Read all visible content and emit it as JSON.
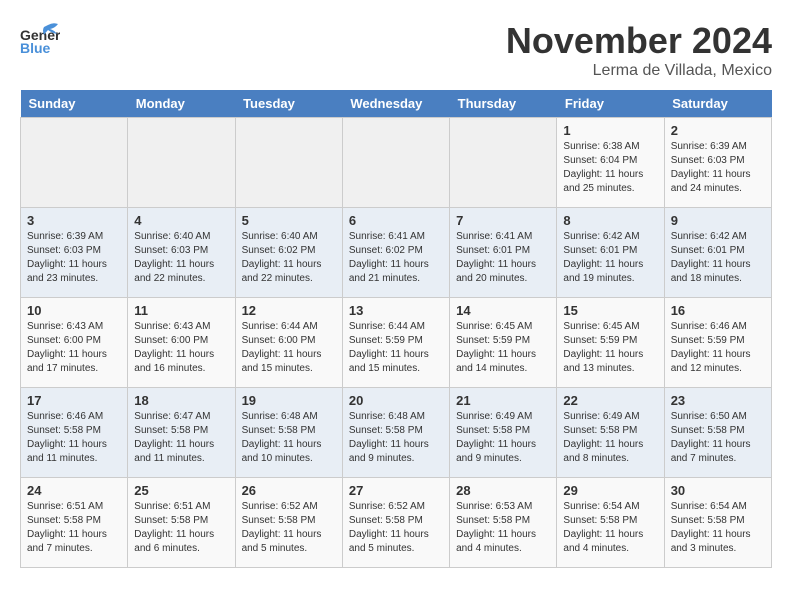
{
  "logo": {
    "line1": "General",
    "line2": "Blue"
  },
  "title": "November 2024",
  "subtitle": "Lerma de Villada, Mexico",
  "weekdays": [
    "Sunday",
    "Monday",
    "Tuesday",
    "Wednesday",
    "Thursday",
    "Friday",
    "Saturday"
  ],
  "weeks": [
    [
      {
        "day": "",
        "info": ""
      },
      {
        "day": "",
        "info": ""
      },
      {
        "day": "",
        "info": ""
      },
      {
        "day": "",
        "info": ""
      },
      {
        "day": "",
        "info": ""
      },
      {
        "day": "1",
        "info": "Sunrise: 6:38 AM\nSunset: 6:04 PM\nDaylight: 11 hours\nand 25 minutes."
      },
      {
        "day": "2",
        "info": "Sunrise: 6:39 AM\nSunset: 6:03 PM\nDaylight: 11 hours\nand 24 minutes."
      }
    ],
    [
      {
        "day": "3",
        "info": "Sunrise: 6:39 AM\nSunset: 6:03 PM\nDaylight: 11 hours\nand 23 minutes."
      },
      {
        "day": "4",
        "info": "Sunrise: 6:40 AM\nSunset: 6:03 PM\nDaylight: 11 hours\nand 22 minutes."
      },
      {
        "day": "5",
        "info": "Sunrise: 6:40 AM\nSunset: 6:02 PM\nDaylight: 11 hours\nand 22 minutes."
      },
      {
        "day": "6",
        "info": "Sunrise: 6:41 AM\nSunset: 6:02 PM\nDaylight: 11 hours\nand 21 minutes."
      },
      {
        "day": "7",
        "info": "Sunrise: 6:41 AM\nSunset: 6:01 PM\nDaylight: 11 hours\nand 20 minutes."
      },
      {
        "day": "8",
        "info": "Sunrise: 6:42 AM\nSunset: 6:01 PM\nDaylight: 11 hours\nand 19 minutes."
      },
      {
        "day": "9",
        "info": "Sunrise: 6:42 AM\nSunset: 6:01 PM\nDaylight: 11 hours\nand 18 minutes."
      }
    ],
    [
      {
        "day": "10",
        "info": "Sunrise: 6:43 AM\nSunset: 6:00 PM\nDaylight: 11 hours\nand 17 minutes."
      },
      {
        "day": "11",
        "info": "Sunrise: 6:43 AM\nSunset: 6:00 PM\nDaylight: 11 hours\nand 16 minutes."
      },
      {
        "day": "12",
        "info": "Sunrise: 6:44 AM\nSunset: 6:00 PM\nDaylight: 11 hours\nand 15 minutes."
      },
      {
        "day": "13",
        "info": "Sunrise: 6:44 AM\nSunset: 5:59 PM\nDaylight: 11 hours\nand 15 minutes."
      },
      {
        "day": "14",
        "info": "Sunrise: 6:45 AM\nSunset: 5:59 PM\nDaylight: 11 hours\nand 14 minutes."
      },
      {
        "day": "15",
        "info": "Sunrise: 6:45 AM\nSunset: 5:59 PM\nDaylight: 11 hours\nand 13 minutes."
      },
      {
        "day": "16",
        "info": "Sunrise: 6:46 AM\nSunset: 5:59 PM\nDaylight: 11 hours\nand 12 minutes."
      }
    ],
    [
      {
        "day": "17",
        "info": "Sunrise: 6:46 AM\nSunset: 5:58 PM\nDaylight: 11 hours\nand 11 minutes."
      },
      {
        "day": "18",
        "info": "Sunrise: 6:47 AM\nSunset: 5:58 PM\nDaylight: 11 hours\nand 11 minutes."
      },
      {
        "day": "19",
        "info": "Sunrise: 6:48 AM\nSunset: 5:58 PM\nDaylight: 11 hours\nand 10 minutes."
      },
      {
        "day": "20",
        "info": "Sunrise: 6:48 AM\nSunset: 5:58 PM\nDaylight: 11 hours\nand 9 minutes."
      },
      {
        "day": "21",
        "info": "Sunrise: 6:49 AM\nSunset: 5:58 PM\nDaylight: 11 hours\nand 9 minutes."
      },
      {
        "day": "22",
        "info": "Sunrise: 6:49 AM\nSunset: 5:58 PM\nDaylight: 11 hours\nand 8 minutes."
      },
      {
        "day": "23",
        "info": "Sunrise: 6:50 AM\nSunset: 5:58 PM\nDaylight: 11 hours\nand 7 minutes."
      }
    ],
    [
      {
        "day": "24",
        "info": "Sunrise: 6:51 AM\nSunset: 5:58 PM\nDaylight: 11 hours\nand 7 minutes."
      },
      {
        "day": "25",
        "info": "Sunrise: 6:51 AM\nSunset: 5:58 PM\nDaylight: 11 hours\nand 6 minutes."
      },
      {
        "day": "26",
        "info": "Sunrise: 6:52 AM\nSunset: 5:58 PM\nDaylight: 11 hours\nand 5 minutes."
      },
      {
        "day": "27",
        "info": "Sunrise: 6:52 AM\nSunset: 5:58 PM\nDaylight: 11 hours\nand 5 minutes."
      },
      {
        "day": "28",
        "info": "Sunrise: 6:53 AM\nSunset: 5:58 PM\nDaylight: 11 hours\nand 4 minutes."
      },
      {
        "day": "29",
        "info": "Sunrise: 6:54 AM\nSunset: 5:58 PM\nDaylight: 11 hours\nand 4 minutes."
      },
      {
        "day": "30",
        "info": "Sunrise: 6:54 AM\nSunset: 5:58 PM\nDaylight: 11 hours\nand 3 minutes."
      }
    ]
  ]
}
